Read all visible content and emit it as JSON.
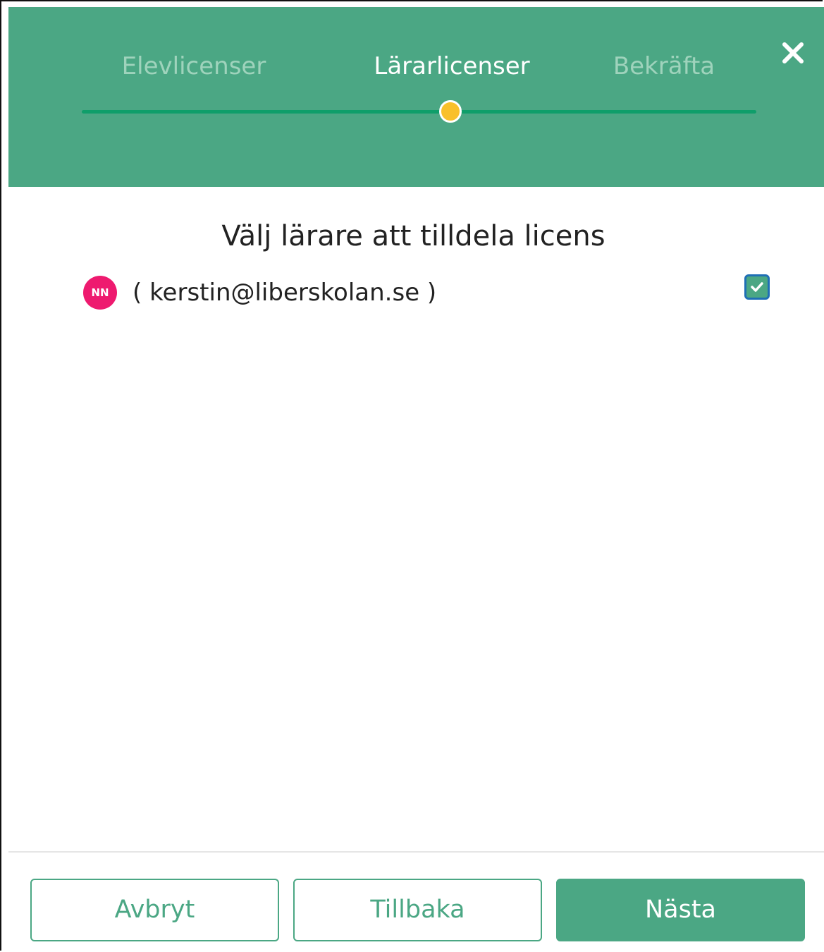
{
  "steps": {
    "step1": "Elevlicenser",
    "step2": "Lärarlicenser",
    "step3": "Bekräfta"
  },
  "active_step": 2,
  "title": "Välj lärare att tilldela licens",
  "teachers": [
    {
      "avatar_initials": "NN",
      "email_display": "( kerstin@liberskolan.se )",
      "checked": true
    }
  ],
  "buttons": {
    "cancel": "Avbryt",
    "back": "Tillbaka",
    "next": "Nästa"
  },
  "colors": {
    "accent": "#4ba784",
    "progress_dot": "#f9c02b",
    "avatar": "#ee1a6f"
  }
}
